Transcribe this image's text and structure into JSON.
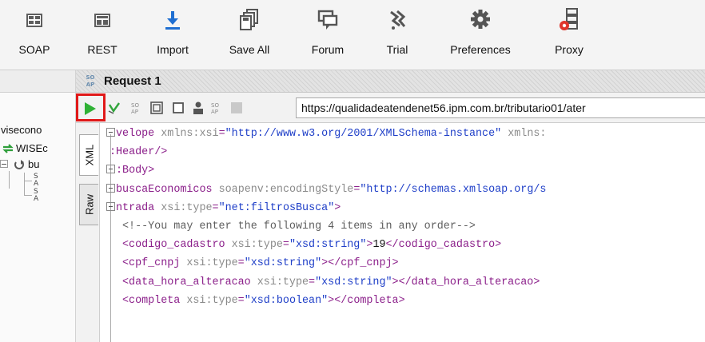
{
  "toolbar": {
    "buttons": [
      {
        "label": "SOAP",
        "icon": "soap-icon"
      },
      {
        "label": "REST",
        "icon": "rest-icon"
      },
      {
        "label": "Import",
        "icon": "import-icon"
      },
      {
        "label": "Save All",
        "icon": "save-all-icon"
      },
      {
        "label": "Forum",
        "icon": "forum-icon"
      },
      {
        "label": "Trial",
        "icon": "trial-icon"
      },
      {
        "label": "Preferences",
        "icon": "gear-icon"
      },
      {
        "label": "Proxy",
        "icon": "proxy-icon"
      }
    ]
  },
  "navigator": {
    "root_label": "visecono",
    "project_label": "WISEc",
    "service_label": "bu",
    "op_codes": [
      "S",
      "A",
      "S",
      "A"
    ]
  },
  "request": {
    "badge_top": "SO",
    "badge_bottom": "AP",
    "title": "Request 1",
    "endpoint": "https://qualidadeatendenet56.ipm.com.br/tributario01/ater",
    "tabs": [
      "XML",
      "Raw"
    ]
  },
  "xml_lines": [
    {
      "fold": true,
      "parts": [
        [
          "tag",
          "velope"
        ],
        [
          "attr",
          " xmlns:xsi"
        ],
        [
          "tag",
          "="
        ],
        [
          "str",
          "\"http://www.w3.org/2001/XMLSchema-instance\""
        ],
        [
          "attr",
          " xmlns:"
        ]
      ]
    },
    {
      "fold": false,
      "parts": [
        [
          "tag",
          ":Header/>"
        ]
      ]
    },
    {
      "fold": true,
      "parts": [
        [
          "tag",
          ":Body>"
        ]
      ]
    },
    {
      "fold": true,
      "parts": [
        [
          "tag",
          "buscaEconomicos"
        ],
        [
          "attr",
          " soapenv:encodingStyle"
        ],
        [
          "tag",
          "="
        ],
        [
          "str",
          "\"http://schemas.xmlsoap.org/s"
        ]
      ]
    },
    {
      "fold": true,
      "parts": [
        [
          "tag",
          "ntrada"
        ],
        [
          "attr",
          " xsi:type"
        ],
        [
          "tag",
          "="
        ],
        [
          "str",
          "\"net:filtrosBusca\""
        ],
        [
          "tag",
          ">"
        ]
      ]
    },
    {
      "fold": false,
      "parts": [
        [
          "com",
          "<!--You may enter the following 4 items in any order-->"
        ]
      ]
    },
    {
      "fold": false,
      "parts": [
        [
          "tag",
          "<codigo_cadastro"
        ],
        [
          "attr",
          " xsi:type"
        ],
        [
          "tag",
          "="
        ],
        [
          "str",
          "\"xsd:string\""
        ],
        [
          "tag",
          ">"
        ],
        [
          "txt",
          "19"
        ],
        [
          "tag",
          "</codigo_cadastro>"
        ]
      ]
    },
    {
      "fold": false,
      "parts": [
        [
          "tag",
          "<cpf_cnpj"
        ],
        [
          "attr",
          " xsi:type"
        ],
        [
          "tag",
          "="
        ],
        [
          "str",
          "\"xsd:string\""
        ],
        [
          "tag",
          "></cpf_cnpj>"
        ]
      ]
    },
    {
      "fold": false,
      "parts": [
        [
          "tag",
          "<data_hora_alteracao"
        ],
        [
          "attr",
          " xsi:type"
        ],
        [
          "tag",
          "="
        ],
        [
          "str",
          "\"xsd:string\""
        ],
        [
          "tag",
          "></data_hora_alteracao>"
        ]
      ]
    },
    {
      "fold": false,
      "parts": [
        [
          "tag",
          "<completa"
        ],
        [
          "attr",
          " xsi:type"
        ],
        [
          "tag",
          "="
        ],
        [
          "str",
          "\"xsd:boolean\""
        ],
        [
          "tag",
          "></completa>"
        ]
      ]
    }
  ]
}
